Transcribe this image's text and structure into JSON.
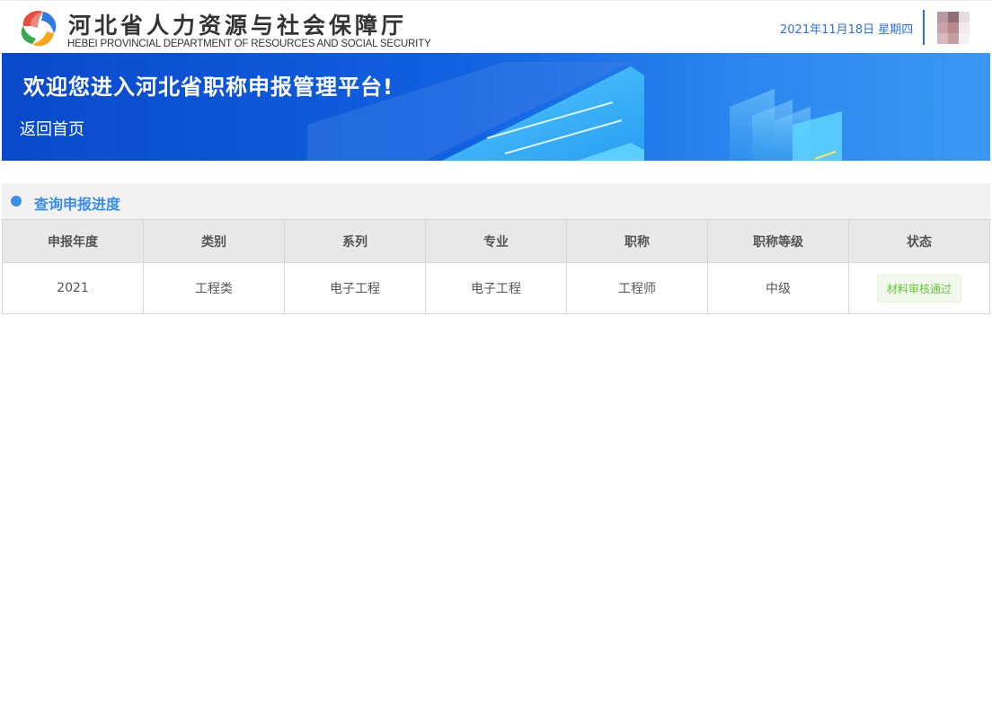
{
  "header": {
    "org_name_cn": "河北省人力资源与社会保障厅",
    "org_name_en": "HEBEI PROVINCIAL DEPARTMENT OF RESOURCES AND SOCIAL SECURITY",
    "date": "2021年11月18日 星期四",
    "logo_icon": "provincial-logo-icon",
    "avatar_icon": "user-avatar-icon"
  },
  "banner": {
    "title": "欢迎您进入河北省职称申报管理平台!",
    "back_link": "返回首页"
  },
  "section": {
    "title": "查询申报进度",
    "accent_color": "#3a8ee6"
  },
  "table": {
    "columns": [
      "申报年度",
      "类别",
      "系列",
      "专业",
      "职称",
      "职称等级",
      "状态"
    ],
    "rows": [
      {
        "year": "2021",
        "category": "工程类",
        "series": "电子工程",
        "major": "电子工程",
        "title": "工程师",
        "level": "中级",
        "status": "材料审核通过",
        "status_color": "#67c23a"
      }
    ]
  }
}
